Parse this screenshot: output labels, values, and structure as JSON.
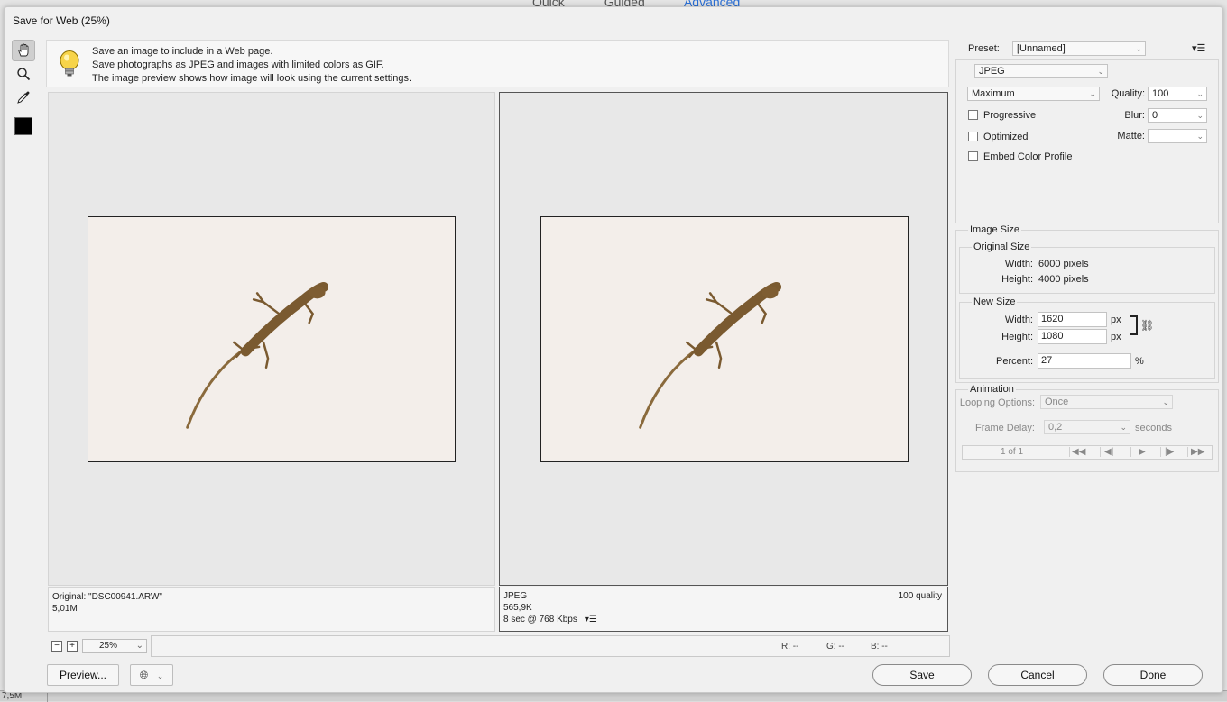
{
  "background_app": {
    "tabs": [
      "Quick",
      "Guided",
      "Advanced"
    ],
    "status_text": "7,5M"
  },
  "dialog": {
    "title": "Save for Web (25%)"
  },
  "toolbox": {
    "tools": [
      "hand-icon",
      "zoom-icon",
      "eyedropper-icon"
    ],
    "foreground_color": "#000000"
  },
  "info_bar": {
    "line1": "Save an image to include in a Web page.",
    "line2": "Save photographs as JPEG and images with limited colors as GIF.",
    "line3": "The image preview shows how image will look using the current settings."
  },
  "original_pane": {
    "name": "Original: \"DSC00941.ARW\"",
    "size": "5,01M"
  },
  "optimized_pane": {
    "format": "JPEG",
    "size": "565,9K",
    "download_time": "8 sec @ 768 Kbps",
    "quality": "100 quality"
  },
  "bottom_bar": {
    "zoom_out": "−",
    "zoom_in": "+",
    "zoom": "25%",
    "r": "R: --",
    "g": "G: --",
    "b": "B: --"
  },
  "buttons": {
    "preview": "Preview...",
    "save": "Save",
    "cancel": "Cancel",
    "done": "Done"
  },
  "settings": {
    "preset_label": "Preset:",
    "preset_value": "[Unnamed]",
    "format": "JPEG",
    "quality_preset": "Maximum",
    "quality_label": "Quality:",
    "quality_value": "100",
    "progressive_label": "Progressive",
    "blur_label": "Blur:",
    "blur_value": "0",
    "optimized_label": "Optimized",
    "matte_label": "Matte:",
    "embed_label": "Embed Color Profile",
    "progressive_checked": false,
    "optimized_checked": false,
    "embed_checked": false
  },
  "image_size": {
    "section": "Image Size",
    "original_title": "Original Size",
    "width_label": "Width:",
    "width_value": "6000 pixels",
    "height_label": "Height:",
    "height_value": "4000 pixels",
    "new_title": "New Size",
    "new_width_label": "Width:",
    "new_width": "1620",
    "new_height_label": "Height:",
    "new_height": "1080",
    "unit": "px",
    "percent_label": "Percent:",
    "percent_value": "27",
    "percent_unit": "%"
  },
  "animation": {
    "section": "Animation",
    "looping_label": "Looping Options:",
    "looping_value": "Once",
    "delay_label": "Frame Delay:",
    "delay_value": "0,2",
    "delay_unit": "seconds",
    "frame_counter": "1 of 1"
  }
}
